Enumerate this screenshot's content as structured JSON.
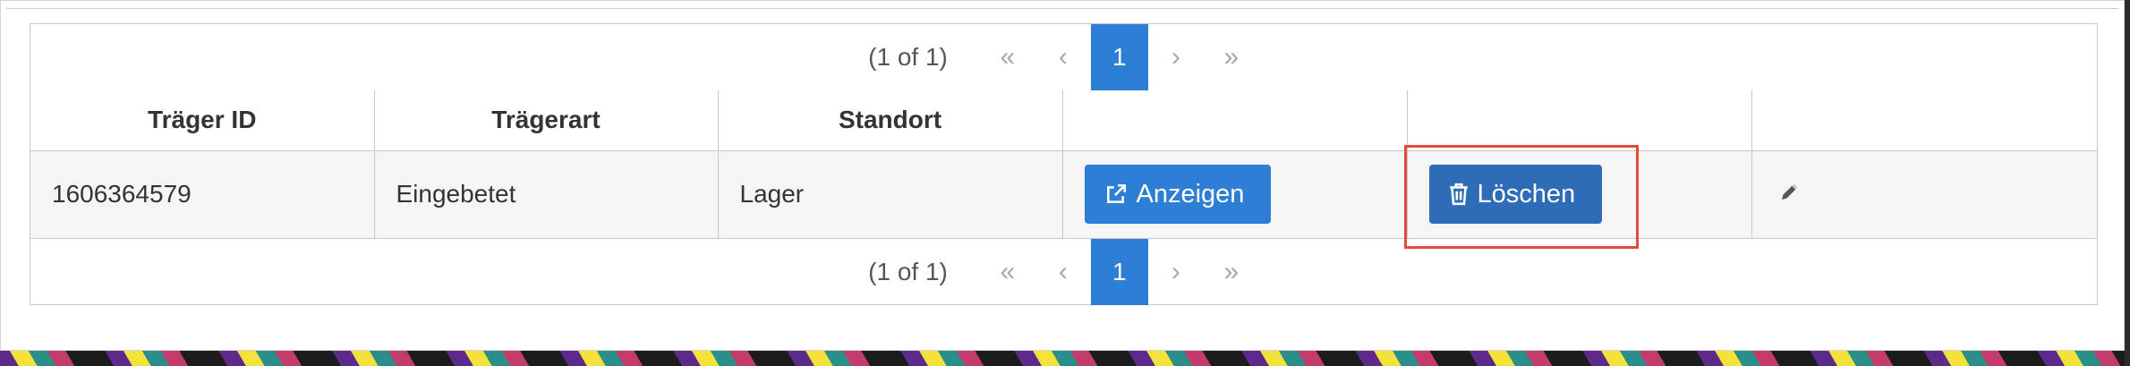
{
  "paginator": {
    "current_report": "(1 of 1)",
    "first_glyph": "«",
    "prev_glyph": "‹",
    "page": "1",
    "next_glyph": "›",
    "last_glyph": "»"
  },
  "table": {
    "columns": [
      "Träger ID",
      "Trägerart",
      "Standort",
      "",
      "",
      ""
    ],
    "rows": [
      {
        "traeger_id": "1606364579",
        "traegerart": "Eingebetet",
        "standort": "Lager",
        "show_label": "Anzeigen",
        "delete_label": "Löschen"
      }
    ]
  },
  "colors": {
    "primary": "#2d7fd6",
    "highlight": "#e24b3b"
  },
  "icons": [
    "double-left-icon",
    "left-icon",
    "right-icon",
    "double-right-icon",
    "external-link-icon",
    "trash-icon",
    "pencil-icon"
  ]
}
